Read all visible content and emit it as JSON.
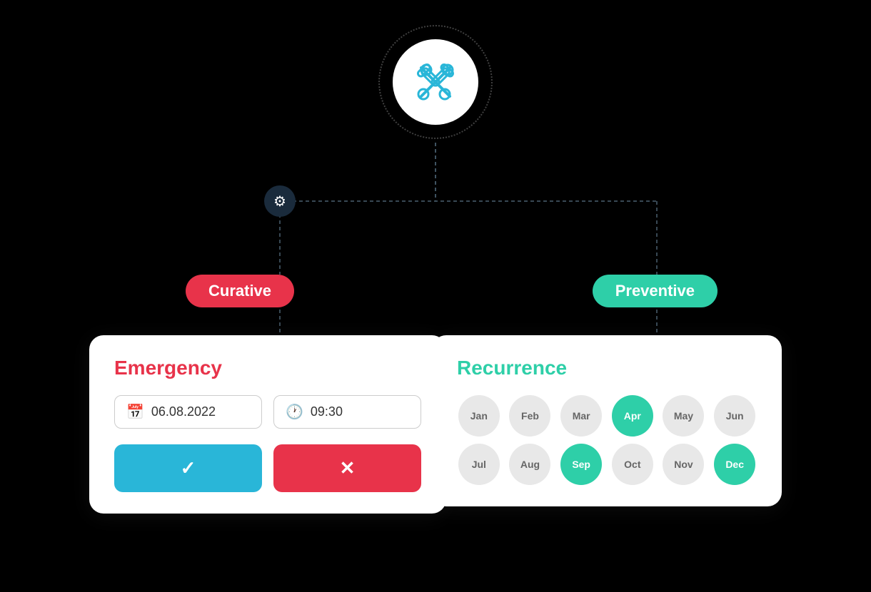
{
  "diagram": {
    "top_icon": "🔧",
    "gear_icon": "⚙",
    "curative_label": "Curative",
    "preventive_label": "Preventive"
  },
  "emergency_card": {
    "title": "Emergency",
    "date_value": "06.08.2022",
    "time_value": "09:30",
    "confirm_icon": "✓",
    "cancel_icon": "✕"
  },
  "recurrence_card": {
    "title": "Recurrence",
    "months": [
      {
        "label": "Jan",
        "active": false
      },
      {
        "label": "Feb",
        "active": false
      },
      {
        "label": "Mar",
        "active": false
      },
      {
        "label": "Apr",
        "active": true
      },
      {
        "label": "May",
        "active": false
      },
      {
        "label": "Jun",
        "active": false
      },
      {
        "label": "Jul",
        "active": false
      },
      {
        "label": "Aug",
        "active": false
      },
      {
        "label": "Sep",
        "active": true
      },
      {
        "label": "Oct",
        "active": false
      },
      {
        "label": "Nov",
        "active": false
      },
      {
        "label": "Dec",
        "active": true
      }
    ]
  },
  "colors": {
    "curative": "#e8334a",
    "preventive": "#2ecfa8",
    "blue": "#29b6d8",
    "gear_bg": "#1a2b3c"
  }
}
